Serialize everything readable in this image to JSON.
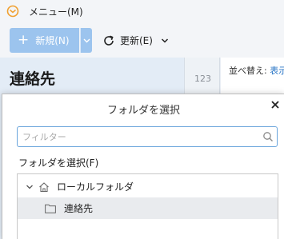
{
  "menubar": {
    "menu_label": "メニュー(M)",
    "logo_icon": "email-app-logo-icon",
    "logo_color": "#f0a030"
  },
  "toolbar": {
    "new_label": "新規(N)",
    "new_icon": "plus-icon",
    "new_dropdown_icon": "chevron-down-icon",
    "refresh_label": "更新(E)",
    "refresh_icon": "refresh-icon",
    "refresh_dropdown_icon": "chevron-down-icon",
    "accent_color": "#9cc4ee"
  },
  "background": {
    "page_title": "連絡先",
    "number_tab": "123",
    "sort_label": "並べ替え:",
    "sort_value": "表示"
  },
  "dialog": {
    "title": "フォルダを選択",
    "close_icon": "close-icon",
    "filter_placeholder": "フィルター",
    "filter_value": "",
    "search_icon": "search-icon",
    "select_label": "フォルダを選択(F)",
    "tree": {
      "root": {
        "label": "ローカルフォルダ",
        "icon": "home-icon",
        "expanded": true
      },
      "children": [
        {
          "label": "連絡先",
          "icon": "folder-icon",
          "selected": true
        }
      ]
    }
  }
}
